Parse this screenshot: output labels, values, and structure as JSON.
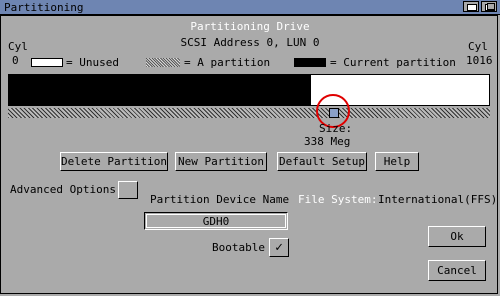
{
  "window": {
    "title": "Partitioning"
  },
  "header": {
    "title": "Partitioning Drive",
    "scsi": "SCSI Address 0, LUN 0"
  },
  "cyl": {
    "left_label": "Cyl",
    "left_value": "0",
    "right_label": "Cyl",
    "right_value": "1016"
  },
  "legend": {
    "unused": "= Unused",
    "partition": "= A partition",
    "current": "= Current partition"
  },
  "partition_bar": {
    "current_fraction": 0.63
  },
  "size": {
    "label": "Size:",
    "value": "338 Meg"
  },
  "buttons": {
    "delete": "Delete Partition",
    "new": "New Partition",
    "default": "Default Setup",
    "help": "Help",
    "ok": "Ok",
    "cancel": "Cancel"
  },
  "advanced": {
    "label": "Advanced Options",
    "checked": false
  },
  "device": {
    "label": "Partition Device Name",
    "value": "GDH0"
  },
  "filesystem": {
    "label": "File System:",
    "value": "International(FFS)"
  },
  "bootable": {
    "label": "Bootable",
    "checked": true,
    "mark": "✓"
  }
}
